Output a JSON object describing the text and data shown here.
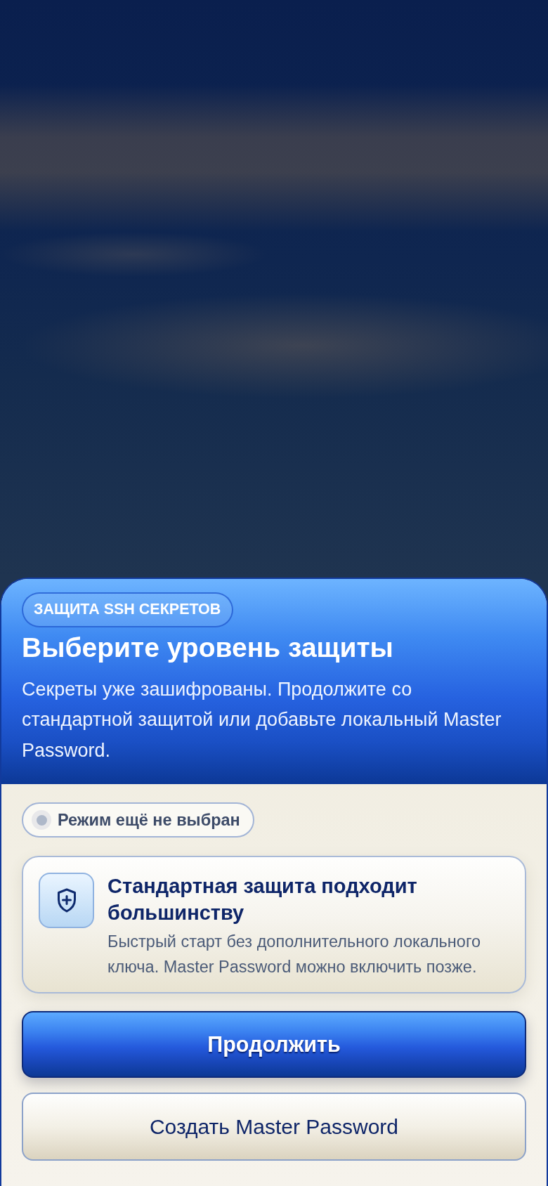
{
  "sheet": {
    "badge": "ЗАЩИТА SSH СЕКРЕТОВ",
    "title": "Выберите уровень защиты",
    "description": "Секреты уже зашифрованы. Продолжите со стандартной защитой или добавьте локальный Master Password."
  },
  "mode_status": {
    "label": "Режим ещё не выбран",
    "active": false
  },
  "recommendation": {
    "title": "Стандартная защита подходит большинству",
    "description": "Быстрый старт без дополнительного локального ключа. Master Password можно включить позже."
  },
  "buttons": [
    {
      "label": "Продолжить",
      "kind": "primary"
    },
    {
      "label": "Создать Master Password",
      "kind": "secondary"
    }
  ]
}
